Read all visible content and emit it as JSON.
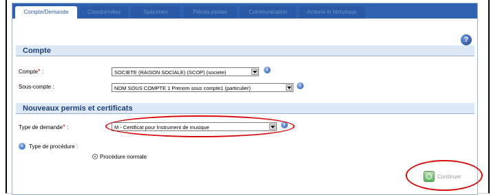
{
  "tabs": [
    {
      "label": "Compte/Demande",
      "active": true
    },
    {
      "label": "Coordonnées",
      "active": false
    },
    {
      "label": "Spécimen",
      "active": false
    },
    {
      "label": "Pièces jointes",
      "active": false
    },
    {
      "label": "Communication",
      "active": false
    },
    {
      "label": "Actions et historique",
      "active": false
    }
  ],
  "sections": {
    "compte": {
      "title": "Compte",
      "fields": {
        "compte": {
          "label": "Compte",
          "value": "SOCIETE (RAISON SOCIALE) (SCOP) (societe)"
        },
        "sous_compte": {
          "label": "Sous-compte :",
          "value": "NOM SOUS COMPTE 1 Prenom sous compte1 (particulier)"
        }
      }
    },
    "permis": {
      "title": "Nouveaux permis et certificats",
      "fields": {
        "type_demande": {
          "label": "Type de demande",
          "value": "M - Certificat pour Instrument de musique"
        },
        "type_procedure": {
          "label": "Type de procédure :",
          "option": "Procédure normale"
        }
      }
    }
  },
  "actions": {
    "continue_label": "Continuer"
  },
  "colors": {
    "tabbar": "#2f63b1",
    "section_bg": "#dde9f7",
    "required": "#e21c1c",
    "highlight": "#d40d0d"
  },
  "icons": {
    "help": "help-icon",
    "info": "info-icon",
    "continue": "check-circle-icon"
  }
}
